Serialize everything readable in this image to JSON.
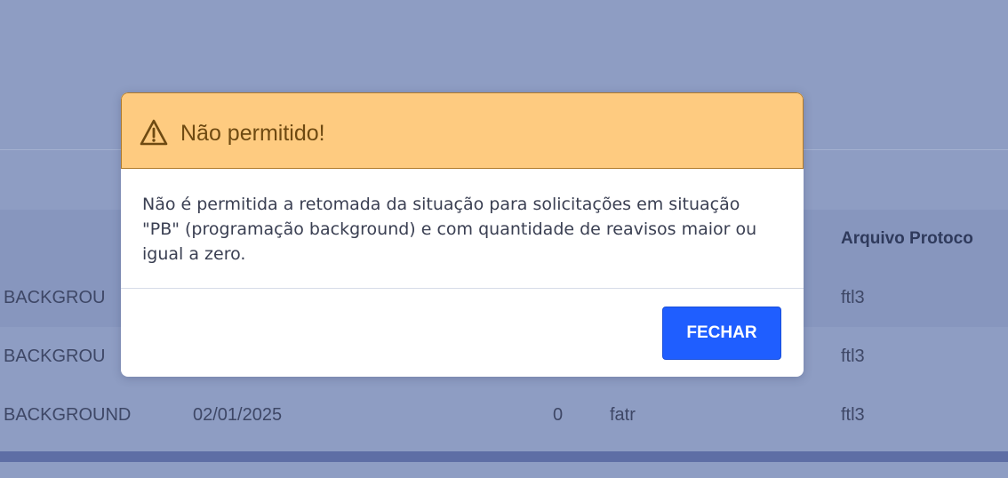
{
  "background_table": {
    "column_header_arquivo": "Arquivo Protoco",
    "rows": [
      {
        "situacao": "BACKGROU",
        "data": "",
        "qtd": "",
        "usuario": "",
        "arquivo": "ftl3"
      },
      {
        "situacao": "BACKGROU",
        "data": "",
        "qtd": "",
        "usuario": "",
        "arquivo": "ftl3"
      },
      {
        "situacao": "BACKGROUND",
        "data": "02/01/2025",
        "qtd": "0",
        "usuario": "fatr",
        "arquivo": "ftl3"
      }
    ]
  },
  "modal": {
    "icon": "warning-triangle-icon",
    "title": "Não permitido!",
    "message": "Não é permitida a retomada da situação para solicitações em situação \"PB\" (programação background) e com quantidade de reavisos maior ou igual a zero.",
    "close_label": "FECHAR"
  },
  "colors": {
    "modal_header_bg": "#fecb80",
    "modal_header_text": "#6e4a12",
    "primary_button": "#1f5eff",
    "overlay_bg": "#8e9dc3"
  }
}
